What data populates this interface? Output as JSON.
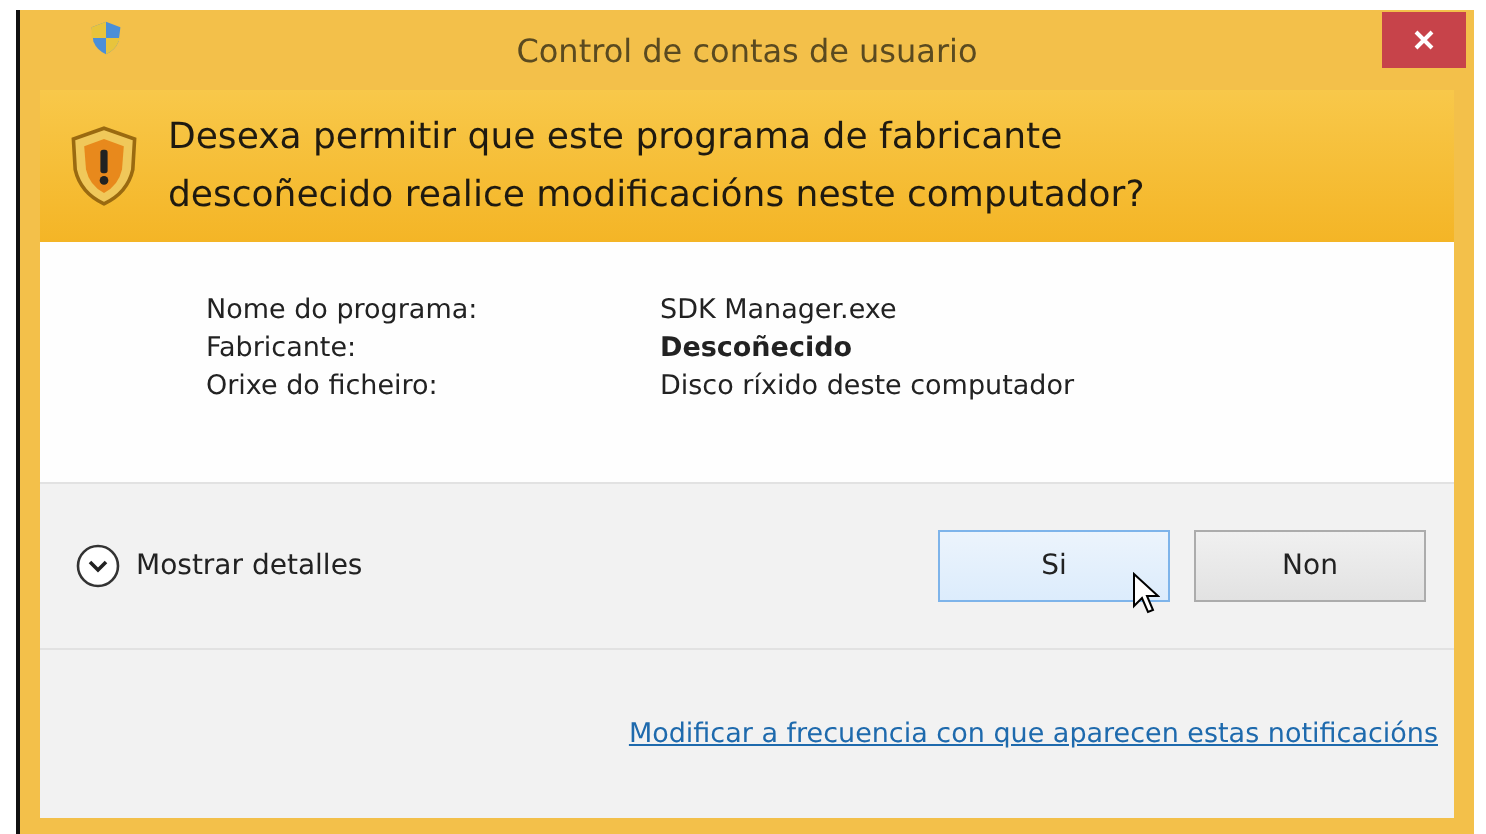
{
  "window": {
    "title": "Control de contas de usuario"
  },
  "question": "Desexa permitir que este programa de fabricante descoñecido realice modificacións neste computador?",
  "details": [
    {
      "label": "Nome do programa:",
      "value": "SDK Manager.exe",
      "bold": false
    },
    {
      "label": "Fabricante:",
      "value": "Descoñecido",
      "bold": true
    },
    {
      "label": "Orixe do ficheiro:",
      "value": "Disco ríxido deste computador",
      "bold": false
    }
  ],
  "expander": {
    "label": "Mostrar detalles",
    "expanded": false
  },
  "buttons": [
    {
      "label": "Si",
      "hovered": true
    },
    {
      "label": "Non",
      "hovered": false
    }
  ],
  "link": "Modificar a frecuencia con que aparecen estas notificacións"
}
